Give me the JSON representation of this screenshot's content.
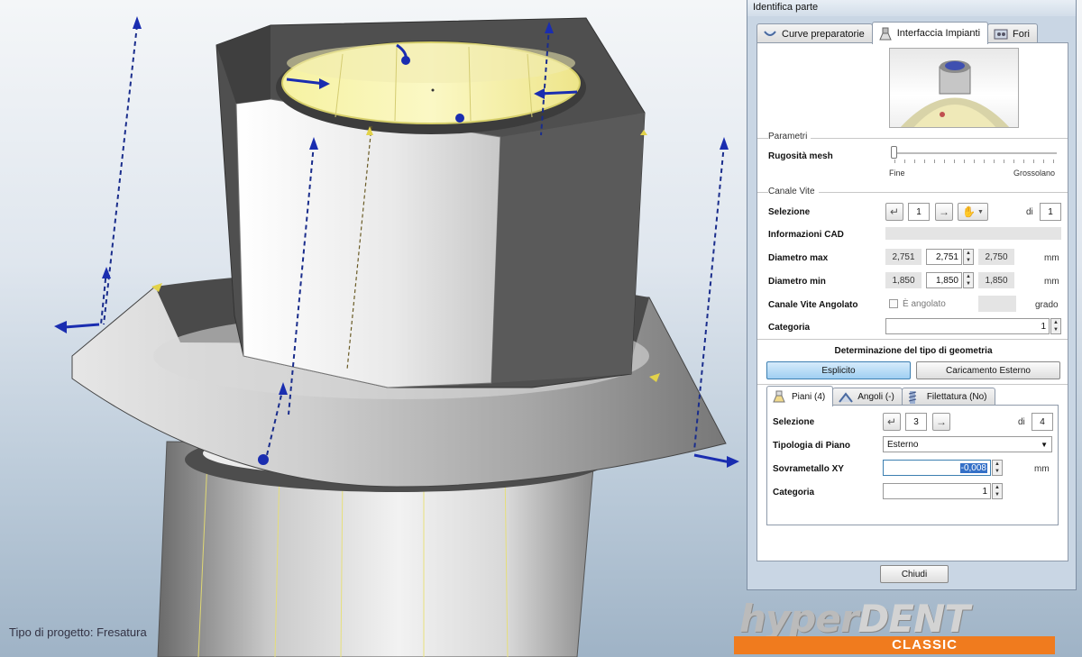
{
  "viewport": {
    "project_type": "Tipo di progetto: Fresatura"
  },
  "logo": {
    "main_dark": "hyper",
    "main_light": "DENT",
    "sub": "CLASSIC",
    "accent_color": "#f07b1e"
  },
  "dialog": {
    "title": "Identifica parte",
    "tabs": [
      {
        "label": "Curve preparatorie",
        "icon": "curve-icon"
      },
      {
        "label": "Interfaccia Impianti",
        "icon": "implant-icon",
        "active": true
      },
      {
        "label": "Fori",
        "icon": "holes-icon"
      }
    ],
    "parametri": {
      "group_label": "Parametri",
      "mesh_label": "Rugosità mesh",
      "slider_min_label": "Fine",
      "slider_max_label": "Grossolano",
      "slider_value": 0
    },
    "canale_vite": {
      "group_label": "Canale Vite",
      "selezione_label": "Selezione",
      "selezione_value": "1",
      "di_label": "di",
      "selezione_total": "1",
      "info_cad_label": "Informazioni CAD",
      "diam_max_label": "Diametro max",
      "diam_max_left": "2,751",
      "diam_max_value": "2,751",
      "diam_max_right": "2,750",
      "diam_min_label": "Diametro min",
      "diam_min_left": "1,850",
      "diam_min_value": "1,850",
      "diam_min_right": "1,850",
      "unit_mm": "mm",
      "angolato_label": "Canale Vite Angolato",
      "angolato_check_label": "È angolato",
      "unit_grado": "grado",
      "categoria_label": "Categoria",
      "categoria_value": "1"
    },
    "geometria": {
      "heading": "Determinazione del tipo di geometria",
      "btn_esplicito": "Esplicito",
      "btn_esterno": "Caricamento Esterno"
    },
    "subtabs": [
      {
        "label": "Piani (4)",
        "icon": "plane-icon",
        "active": true
      },
      {
        "label": "Angoli (-)",
        "icon": "angle-icon"
      },
      {
        "label": "Filettatura (No)",
        "icon": "thread-icon"
      }
    ],
    "piani": {
      "selezione_label": "Selezione",
      "selezione_value": "3",
      "di_label": "di",
      "selezione_total": "4",
      "tipologia_label": "Tipologia di Piano",
      "tipologia_value": "Esterno",
      "sovrametallo_label": "Sovrametallo XY",
      "sovrametallo_value": "-0,008",
      "unit_mm": "mm",
      "categoria_label": "Categoria",
      "categoria_value": "1"
    },
    "close_label": "Chiudi"
  }
}
